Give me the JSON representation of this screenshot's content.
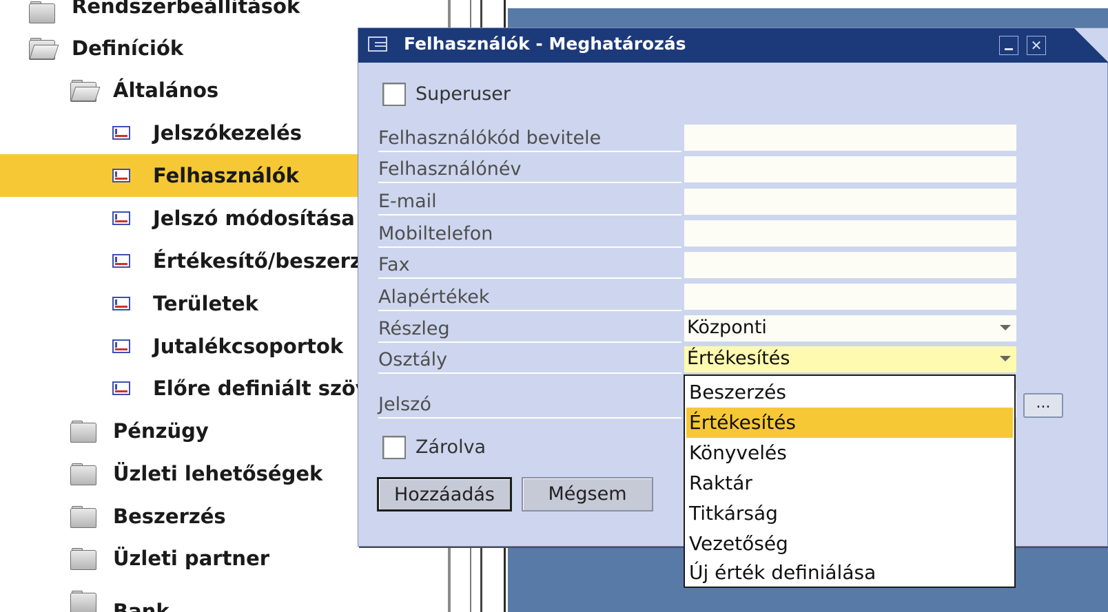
{
  "tree": {
    "items": [
      {
        "label": "Rendszerbeállítások",
        "icon": "folder-icon"
      },
      {
        "label": "Definíciók",
        "icon": "folder-open-icon"
      },
      {
        "label": "Általános",
        "icon": "folder-open-icon"
      },
      {
        "label": "Jelszókezelés",
        "icon": "form-icon"
      },
      {
        "label": "Felhasználók",
        "icon": "form-icon",
        "selected": true
      },
      {
        "label": "Jelszó módosítása",
        "icon": "form-icon"
      },
      {
        "label": "Értékesítő/beszerző",
        "icon": "form-icon"
      },
      {
        "label": "Területek",
        "icon": "form-icon"
      },
      {
        "label": "Jutalékcsoportok",
        "icon": "form-icon"
      },
      {
        "label": "Előre definiált szövegek",
        "icon": "form-icon"
      },
      {
        "label": "Pénzügy",
        "icon": "folder-icon"
      },
      {
        "label": "Üzleti lehetőségek",
        "icon": "folder-icon"
      },
      {
        "label": "Beszerzés",
        "icon": "folder-icon"
      },
      {
        "label": "Üzleti partner",
        "icon": "folder-icon"
      },
      {
        "label": "Bank",
        "icon": "folder-icon"
      }
    ]
  },
  "dialog": {
    "title": "Felhasználók - Meghatározás",
    "superuser_label": "Superuser",
    "locked_label": "Zárolva",
    "fields": [
      {
        "label": "Felhasználókód bevitele",
        "value": ""
      },
      {
        "label": "Felhasználónév",
        "value": ""
      },
      {
        "label": "E-mail",
        "value": ""
      },
      {
        "label": "Mobiltelefon",
        "value": ""
      },
      {
        "label": "Fax",
        "value": ""
      },
      {
        "label": "Alapértékek",
        "value": ""
      },
      {
        "label": "Részleg",
        "value": "Központi"
      },
      {
        "label": "Osztály",
        "value": "Értékesítés"
      },
      {
        "label": "Jelszó",
        "value": ""
      }
    ],
    "ellipsis_label": "...",
    "add_label": "Hozzáadás",
    "cancel_label": "Mégsem"
  },
  "dropdown": {
    "options": [
      "Beszerzés",
      "Értékesítés",
      "Könyvelés",
      "Raktár",
      "Titkárság",
      "Vezetőség",
      "Új érték definiálása"
    ],
    "highlighted": "Értékesítés"
  },
  "colors": {
    "selection": "#f7c836",
    "titlebar": "#1c3a7a",
    "dialog_bg": "#cdd6ee",
    "desktop": "#587aa6"
  }
}
